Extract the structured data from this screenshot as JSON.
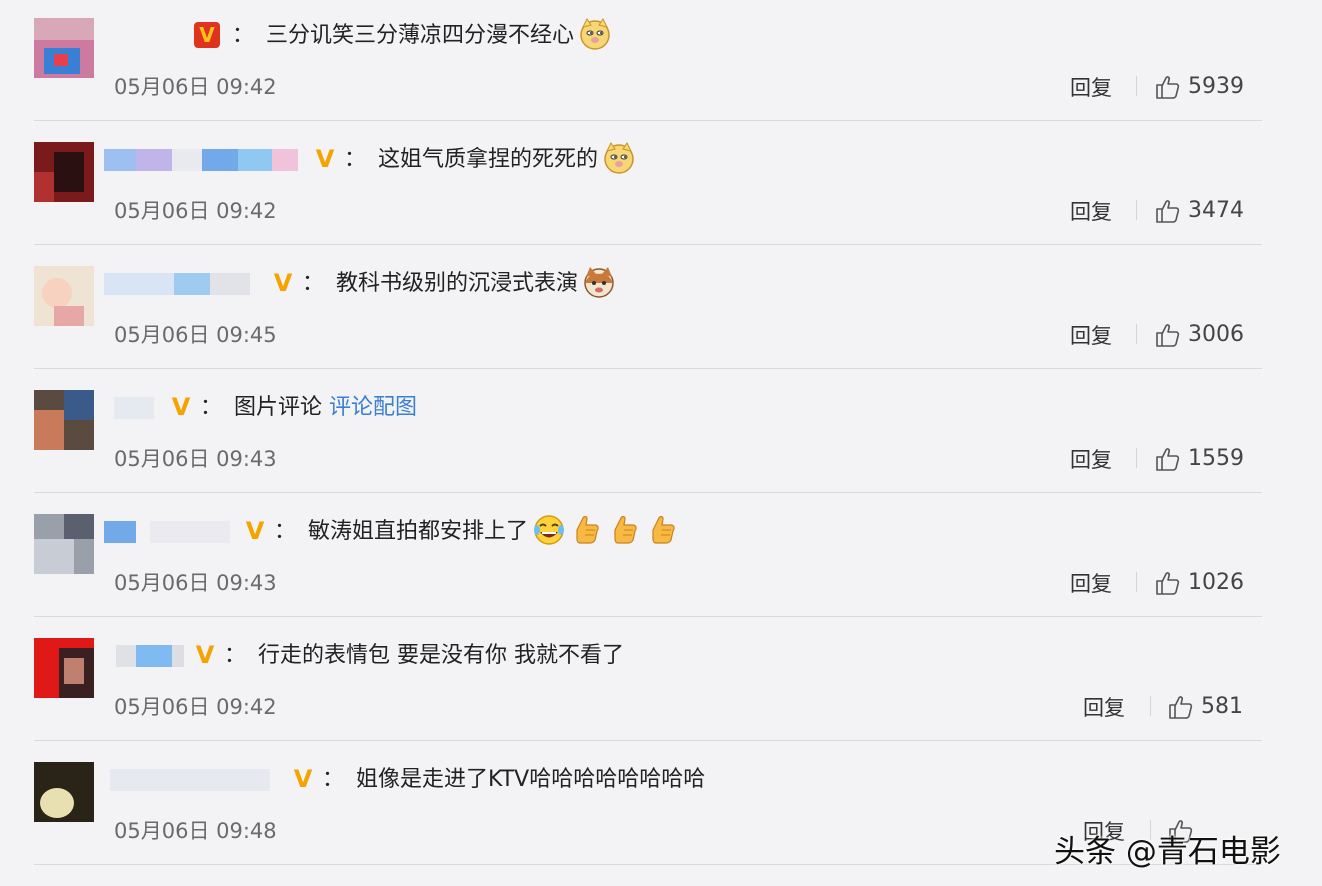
{
  "comments": [
    {
      "text": "三分讥笑三分薄凉四分漫不经心",
      "link": "",
      "time": "05月06日 09:42",
      "reply": "回复",
      "likes": "5939",
      "emojis": [
        "doge"
      ],
      "badge": "V",
      "badge_style": "red"
    },
    {
      "text": "这姐气质拿捏的死死的",
      "link": "",
      "time": "05月06日 09:42",
      "reply": "回复",
      "likes": "3474",
      "emojis": [
        "doge"
      ],
      "badge": "V",
      "badge_style": "plain"
    },
    {
      "text": "教科书级别的沉浸式表演",
      "link": "",
      "time": "05月06日 09:45",
      "reply": "回复",
      "likes": "3006",
      "emojis": [
        "cat-doge"
      ],
      "badge": "V",
      "badge_style": "plain"
    },
    {
      "text": "图片评论",
      "link": "评论配图",
      "time": "05月06日 09:43",
      "reply": "回复",
      "likes": "1559",
      "emojis": [],
      "badge": "V",
      "badge_style": "plain"
    },
    {
      "text": "敏涛姐直拍都安排上了",
      "link": "",
      "time": "05月06日 09:43",
      "reply": "回复",
      "likes": "1026",
      "emojis": [
        "laugh-cry",
        "thumbs-up",
        "thumbs-up",
        "thumbs-up"
      ],
      "badge": "V",
      "badge_style": "plain"
    },
    {
      "text": "行走的表情包 要是没有你 我就不看了",
      "link": "",
      "time": "05月06日 09:42",
      "reply": "回复",
      "likes": "581",
      "emojis": [],
      "badge": "V",
      "badge_style": "plain"
    },
    {
      "text": "姐像是走进了KTV哈哈哈哈哈哈哈哈",
      "link": "",
      "time": "05月06日 09:48",
      "reply": "回复",
      "likes": "",
      "emojis": [],
      "badge": "V",
      "badge_style": "plain"
    }
  ],
  "colon": "：",
  "watermark": "头条 @青石电影",
  "colors": {
    "link": "#3b7fd1",
    "badge": "#f5a300",
    "badge_red_bg": "#e0331f"
  }
}
